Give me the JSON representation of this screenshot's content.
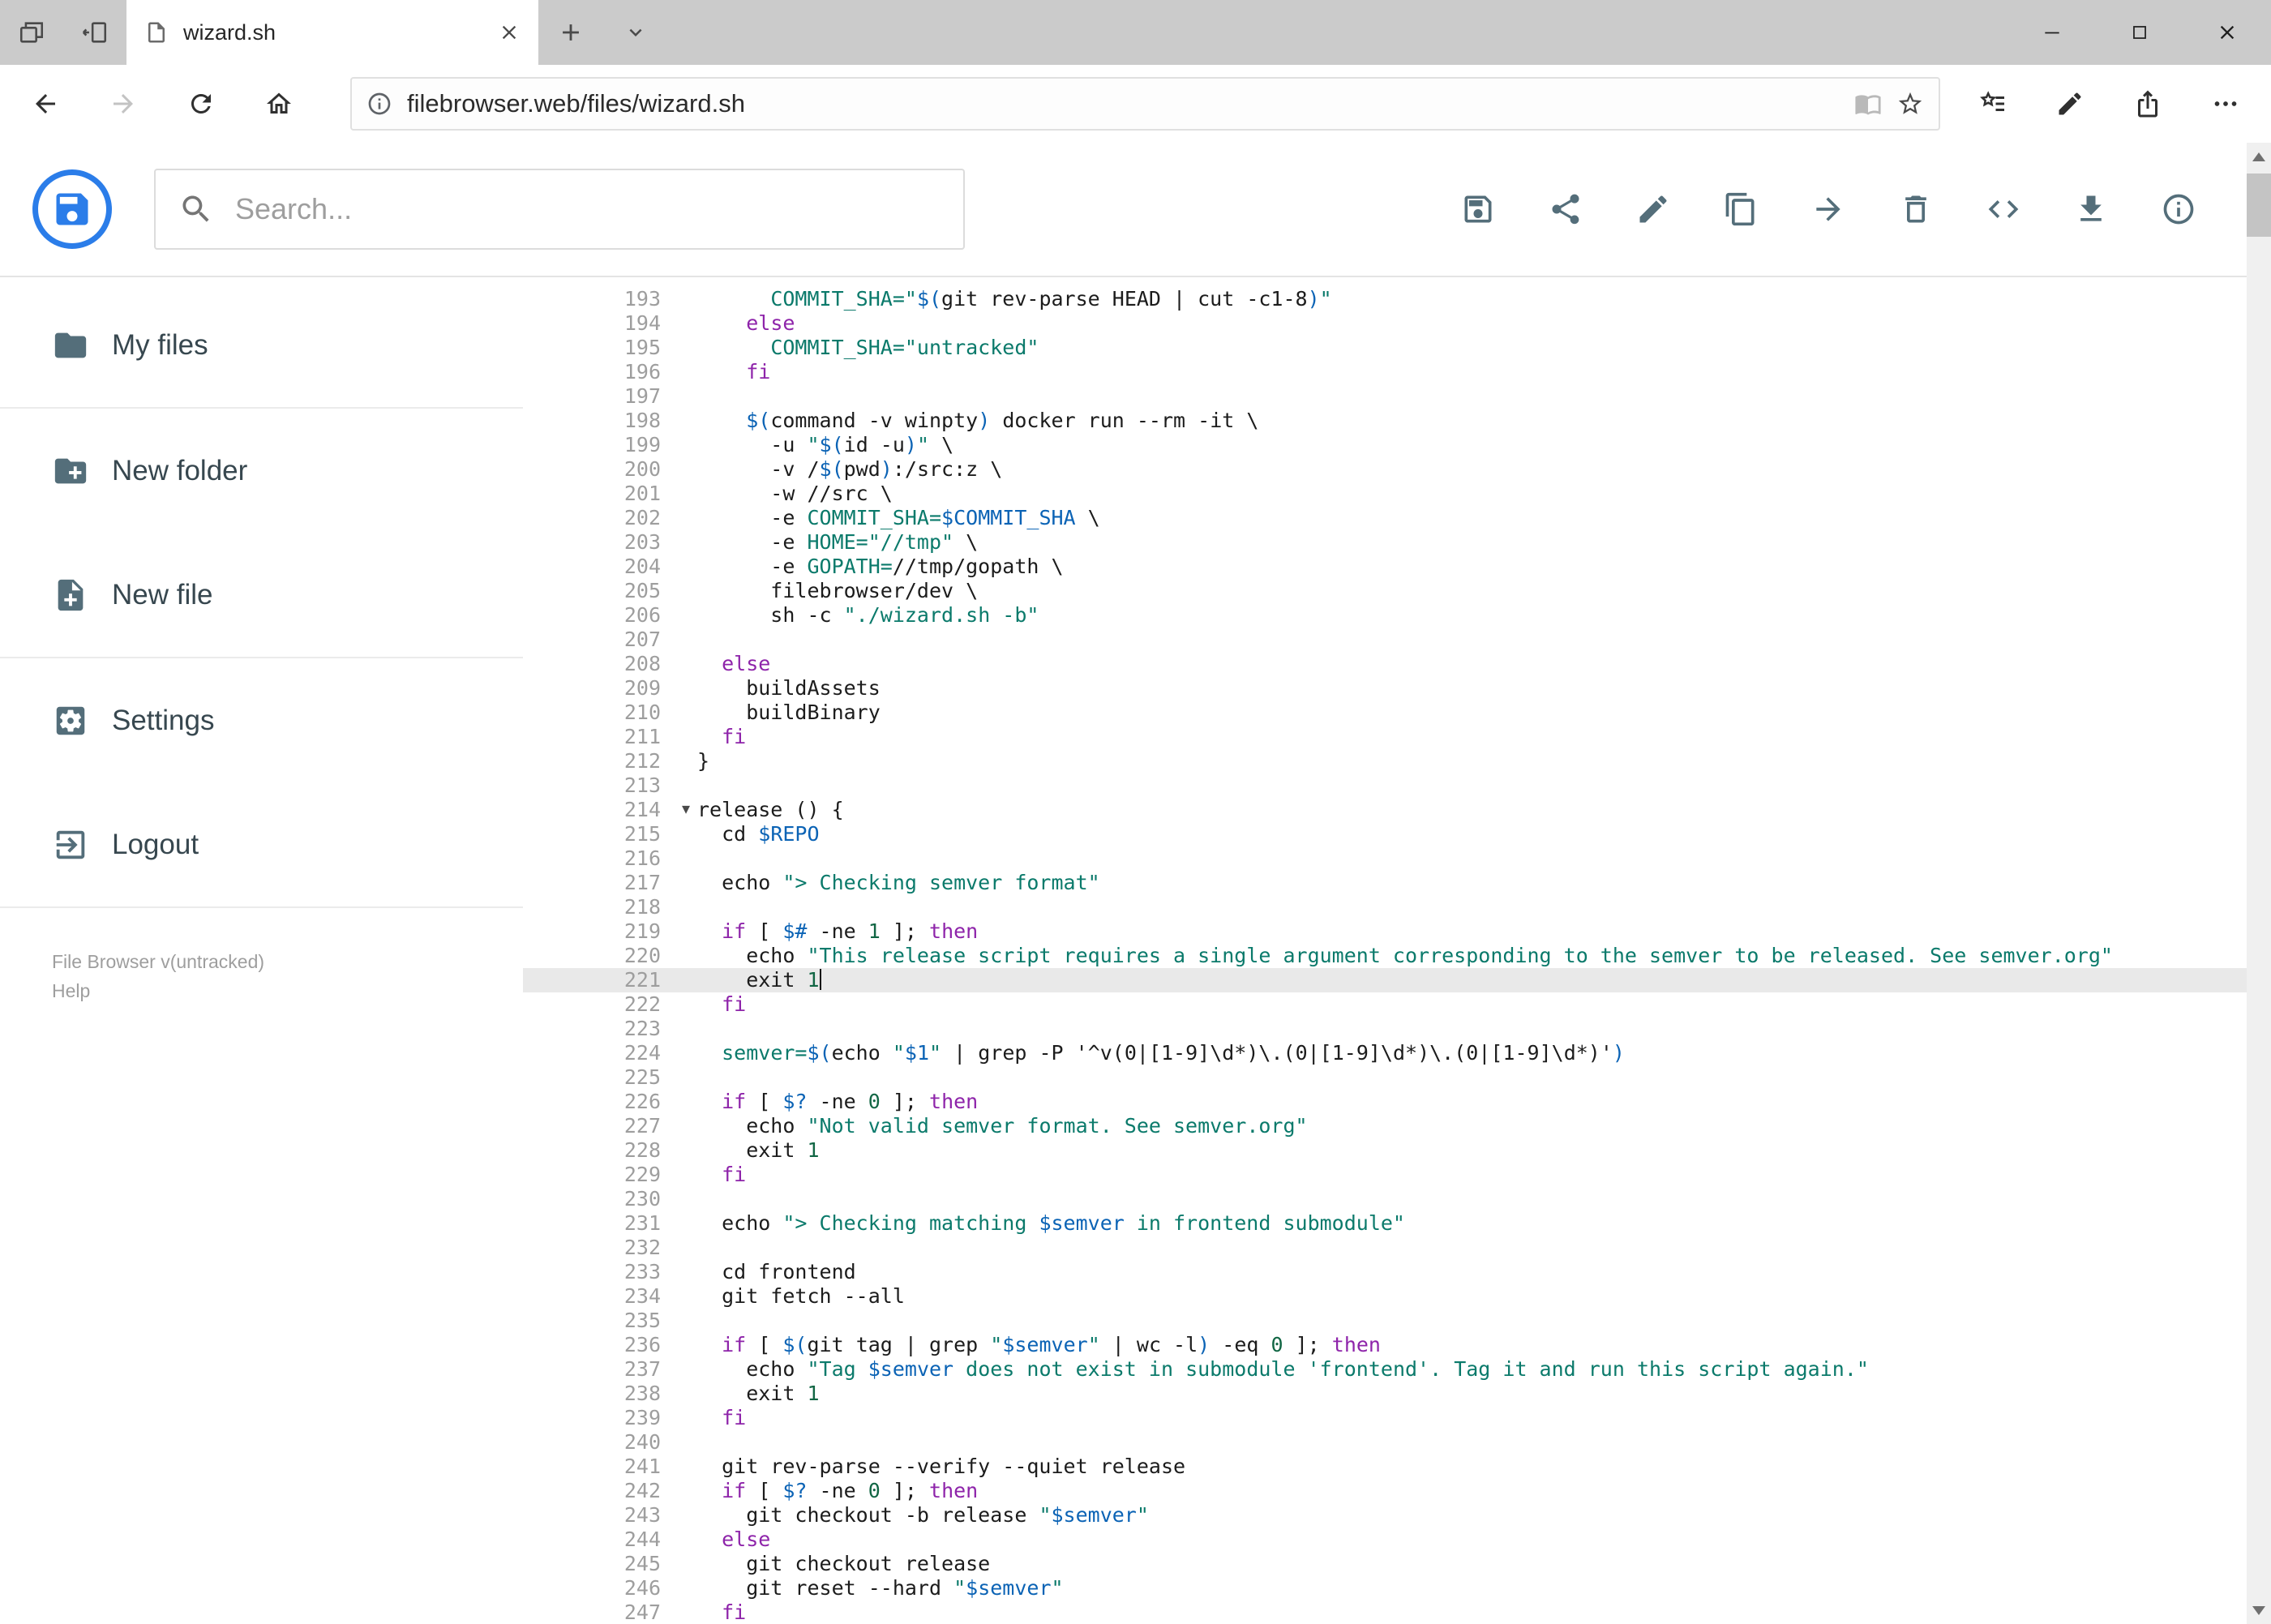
{
  "browser": {
    "tabstrip": {
      "tab_title": "wizard.sh"
    },
    "address": {
      "url": "filebrowser.web/files/wizard.sh"
    },
    "chrome_icons": {
      "tabstrip": [
        "tabs-preview",
        "set-aside",
        "page",
        "close",
        "plus",
        "chevron-down",
        "minimize",
        "maximize",
        "close"
      ],
      "navbar": [
        "back",
        "forward",
        "refresh",
        "home",
        "info-small",
        "reading",
        "star",
        "hub",
        "web-note",
        "edge-share",
        "more"
      ]
    }
  },
  "header": {
    "search_placeholder": "Search...",
    "logo_icon": "floppy",
    "search_icon": "search",
    "toolbar": [
      {
        "icon": "save"
      },
      {
        "icon": "share"
      },
      {
        "icon": "edit"
      },
      {
        "icon": "copy"
      },
      {
        "icon": "move"
      },
      {
        "icon": "delete"
      },
      {
        "icon": "code"
      },
      {
        "icon": "download"
      },
      {
        "icon": "info"
      }
    ]
  },
  "sidebar": {
    "items": [
      {
        "icon": "folder",
        "label": "My files",
        "divider_after": true
      },
      {
        "icon": "new-folder",
        "label": "New folder",
        "divider_after": false
      },
      {
        "icon": "new-file",
        "label": "New file",
        "divider_after": true
      },
      {
        "icon": "settings",
        "label": "Settings",
        "divider_after": false
      },
      {
        "icon": "logout",
        "label": "Logout",
        "divider_after": true
      }
    ],
    "footer": [
      "File Browser v(untracked)",
      "Help"
    ]
  },
  "editor": {
    "active_line": 221,
    "cursor_line": 221,
    "fold_marker_lines": [
      214
    ],
    "syntax_colors": {
      "keyword": "#8e24aa",
      "string": "#0b7a6b",
      "variable": "#0b63b5",
      "number": "#116644",
      "plain": "#1c1c1c",
      "gutter": "#9e9e9e",
      "active_line_bg": "#e9e9e9"
    },
    "lines": [
      {
        "n": 193,
        "t": [
          [
            "p",
            "      "
          ],
          [
            "s",
            "COMMIT_SHA=\""
          ],
          [
            "v",
            "$("
          ],
          [
            "p",
            "git rev-parse HEAD | cut -c1-8"
          ],
          [
            "v",
            ")"
          ],
          [
            "s",
            "\""
          ]
        ]
      },
      {
        "n": 194,
        "t": [
          [
            "p",
            "    "
          ],
          [
            "k",
            "else"
          ]
        ]
      },
      {
        "n": 195,
        "t": [
          [
            "p",
            "      "
          ],
          [
            "s",
            "COMMIT_SHA=\"untracked\""
          ]
        ]
      },
      {
        "n": 196,
        "t": [
          [
            "p",
            "    "
          ],
          [
            "k",
            "fi"
          ]
        ]
      },
      {
        "n": 197,
        "t": []
      },
      {
        "n": 198,
        "t": [
          [
            "p",
            "    "
          ],
          [
            "v",
            "$("
          ],
          [
            "p",
            "command -v winpty"
          ],
          [
            "v",
            ")"
          ],
          [
            "p",
            " docker run --rm -it \\"
          ]
        ]
      },
      {
        "n": 199,
        "t": [
          [
            "p",
            "      -u "
          ],
          [
            "s",
            "\""
          ],
          [
            "v",
            "$("
          ],
          [
            "p",
            "id -u"
          ],
          [
            "v",
            ")"
          ],
          [
            "s",
            "\""
          ],
          [
            "p",
            " \\"
          ]
        ]
      },
      {
        "n": 200,
        "t": [
          [
            "p",
            "      -v /"
          ],
          [
            "v",
            "$("
          ],
          [
            "p",
            "pwd"
          ],
          [
            "v",
            ")"
          ],
          [
            "p",
            ":/src:z \\"
          ]
        ]
      },
      {
        "n": 201,
        "t": [
          [
            "p",
            "      -w //src \\"
          ]
        ]
      },
      {
        "n": 202,
        "t": [
          [
            "p",
            "      -e "
          ],
          [
            "s",
            "COMMIT_SHA="
          ],
          [
            "v",
            "$COMMIT_SHA"
          ],
          [
            "p",
            " \\"
          ]
        ]
      },
      {
        "n": 203,
        "t": [
          [
            "p",
            "      -e "
          ],
          [
            "s",
            "HOME=\"//tmp\""
          ],
          [
            "p",
            " \\"
          ]
        ]
      },
      {
        "n": 204,
        "t": [
          [
            "p",
            "      -e "
          ],
          [
            "s",
            "GOPATH="
          ],
          [
            "p",
            "//tmp/gopath \\"
          ]
        ]
      },
      {
        "n": 205,
        "t": [
          [
            "p",
            "      filebrowser/dev \\"
          ]
        ]
      },
      {
        "n": 206,
        "t": [
          [
            "p",
            "      sh -c "
          ],
          [
            "s",
            "\"./wizard.sh -b\""
          ]
        ]
      },
      {
        "n": 207,
        "t": []
      },
      {
        "n": 208,
        "t": [
          [
            "p",
            "  "
          ],
          [
            "k",
            "else"
          ]
        ]
      },
      {
        "n": 209,
        "t": [
          [
            "p",
            "    buildAssets"
          ]
        ]
      },
      {
        "n": 210,
        "t": [
          [
            "p",
            "    buildBinary"
          ]
        ]
      },
      {
        "n": 211,
        "t": [
          [
            "p",
            "  "
          ],
          [
            "k",
            "fi"
          ]
        ]
      },
      {
        "n": 212,
        "t": [
          [
            "p",
            "}"
          ]
        ]
      },
      {
        "n": 213,
        "t": []
      },
      {
        "n": 214,
        "t": [
          [
            "p",
            "release () {"
          ]
        ]
      },
      {
        "n": 215,
        "t": [
          [
            "p",
            "  cd "
          ],
          [
            "v",
            "$REPO"
          ]
        ]
      },
      {
        "n": 216,
        "t": []
      },
      {
        "n": 217,
        "t": [
          [
            "p",
            "  echo "
          ],
          [
            "s",
            "\"> Checking semver format\""
          ]
        ]
      },
      {
        "n": 218,
        "t": []
      },
      {
        "n": 219,
        "t": [
          [
            "p",
            "  "
          ],
          [
            "k",
            "if"
          ],
          [
            "p",
            " [ "
          ],
          [
            "v",
            "$#"
          ],
          [
            "p",
            " -ne "
          ],
          [
            "n",
            "1"
          ],
          [
            "p",
            " ]; "
          ],
          [
            "k",
            "then"
          ]
        ]
      },
      {
        "n": 220,
        "t": [
          [
            "p",
            "    echo "
          ],
          [
            "s",
            "\"This release script requires a single argument corresponding to the semver to be released. See semver.org\""
          ]
        ]
      },
      {
        "n": 221,
        "t": [
          [
            "p",
            "    exit "
          ],
          [
            "n",
            "1"
          ]
        ]
      },
      {
        "n": 222,
        "t": [
          [
            "p",
            "  "
          ],
          [
            "k",
            "fi"
          ]
        ]
      },
      {
        "n": 223,
        "t": []
      },
      {
        "n": 224,
        "t": [
          [
            "p",
            "  "
          ],
          [
            "s",
            "semver="
          ],
          [
            "v",
            "$("
          ],
          [
            "p",
            "echo "
          ],
          [
            "s",
            "\""
          ],
          [
            "v",
            "$1"
          ],
          [
            "s",
            "\""
          ],
          [
            "p",
            " | grep -P '^v(0|[1-9]\\d*)\\.(0|[1-9]\\d*)\\.(0|[1-9]\\d*)'"
          ],
          [
            "v",
            ")"
          ]
        ]
      },
      {
        "n": 225,
        "t": []
      },
      {
        "n": 226,
        "t": [
          [
            "p",
            "  "
          ],
          [
            "k",
            "if"
          ],
          [
            "p",
            " [ "
          ],
          [
            "v",
            "$?"
          ],
          [
            "p",
            " -ne "
          ],
          [
            "n",
            "0"
          ],
          [
            "p",
            " ]; "
          ],
          [
            "k",
            "then"
          ]
        ]
      },
      {
        "n": 227,
        "t": [
          [
            "p",
            "    echo "
          ],
          [
            "s",
            "\"Not valid semver format. See semver.org\""
          ]
        ]
      },
      {
        "n": 228,
        "t": [
          [
            "p",
            "    exit "
          ],
          [
            "n",
            "1"
          ]
        ]
      },
      {
        "n": 229,
        "t": [
          [
            "p",
            "  "
          ],
          [
            "k",
            "fi"
          ]
        ]
      },
      {
        "n": 230,
        "t": []
      },
      {
        "n": 231,
        "t": [
          [
            "p",
            "  echo "
          ],
          [
            "s",
            "\"> Checking matching "
          ],
          [
            "v",
            "$semver"
          ],
          [
            "s",
            " in frontend submodule\""
          ]
        ]
      },
      {
        "n": 232,
        "t": []
      },
      {
        "n": 233,
        "t": [
          [
            "p",
            "  cd frontend"
          ]
        ]
      },
      {
        "n": 234,
        "t": [
          [
            "p",
            "  git fetch --all"
          ]
        ]
      },
      {
        "n": 235,
        "t": []
      },
      {
        "n": 236,
        "t": [
          [
            "p",
            "  "
          ],
          [
            "k",
            "if"
          ],
          [
            "p",
            " [ "
          ],
          [
            "v",
            "$("
          ],
          [
            "p",
            "git tag | grep "
          ],
          [
            "s",
            "\""
          ],
          [
            "v",
            "$semver"
          ],
          [
            "s",
            "\""
          ],
          [
            "p",
            " | wc -l"
          ],
          [
            "v",
            ")"
          ],
          [
            "p",
            " -eq "
          ],
          [
            "n",
            "0"
          ],
          [
            "p",
            " ]; "
          ],
          [
            "k",
            "then"
          ]
        ]
      },
      {
        "n": 237,
        "t": [
          [
            "p",
            "    echo "
          ],
          [
            "s",
            "\"Tag "
          ],
          [
            "v",
            "$semver"
          ],
          [
            "s",
            " does not exist in submodule 'frontend'. Tag it and run this script again.\""
          ]
        ]
      },
      {
        "n": 238,
        "t": [
          [
            "p",
            "    exit "
          ],
          [
            "n",
            "1"
          ]
        ]
      },
      {
        "n": 239,
        "t": [
          [
            "p",
            "  "
          ],
          [
            "k",
            "fi"
          ]
        ]
      },
      {
        "n": 240,
        "t": []
      },
      {
        "n": 241,
        "t": [
          [
            "p",
            "  git rev-parse --verify --quiet release"
          ]
        ]
      },
      {
        "n": 242,
        "t": [
          [
            "p",
            "  "
          ],
          [
            "k",
            "if"
          ],
          [
            "p",
            " [ "
          ],
          [
            "v",
            "$?"
          ],
          [
            "p",
            " -ne "
          ],
          [
            "n",
            "0"
          ],
          [
            "p",
            " ]; "
          ],
          [
            "k",
            "then"
          ]
        ]
      },
      {
        "n": 243,
        "t": [
          [
            "p",
            "    git checkout -b release "
          ],
          [
            "s",
            "\""
          ],
          [
            "v",
            "$semver"
          ],
          [
            "s",
            "\""
          ]
        ]
      },
      {
        "n": 244,
        "t": [
          [
            "p",
            "  "
          ],
          [
            "k",
            "else"
          ]
        ]
      },
      {
        "n": 245,
        "t": [
          [
            "p",
            "    git checkout release"
          ]
        ]
      },
      {
        "n": 246,
        "t": [
          [
            "p",
            "    git reset --hard "
          ],
          [
            "s",
            "\""
          ],
          [
            "v",
            "$semver"
          ],
          [
            "s",
            "\""
          ]
        ]
      },
      {
        "n": 247,
        "t": [
          [
            "p",
            "  "
          ],
          [
            "k",
            "fi"
          ]
        ]
      }
    ]
  }
}
